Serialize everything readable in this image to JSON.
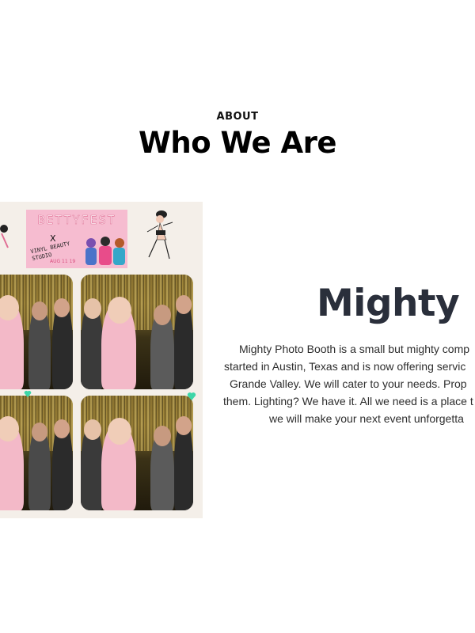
{
  "section": {
    "eyebrow": "ABOUT",
    "title": "Who We Are"
  },
  "photo": {
    "alt": "photo strip",
    "banner_title": "BETTYFEST",
    "banner_x": "X",
    "banner_sub": "VINYL BEAUTY STUDIO",
    "banner_date": "AUG 11 19"
  },
  "feature": {
    "heading": "Mighty",
    "description_lines": [
      "Mighty Photo Booth is a small but mighty comp",
      "started in Austin, Texas and is now offering servic",
      "Grande Valley. We will cater to your needs. Prop",
      "them. Lighting? We have it. All we need is a place t",
      "we will make your next event unforgetta"
    ]
  },
  "colors": {
    "banner_pink": "#f6bcd0",
    "heading_dark": "#2a2f3b"
  }
}
